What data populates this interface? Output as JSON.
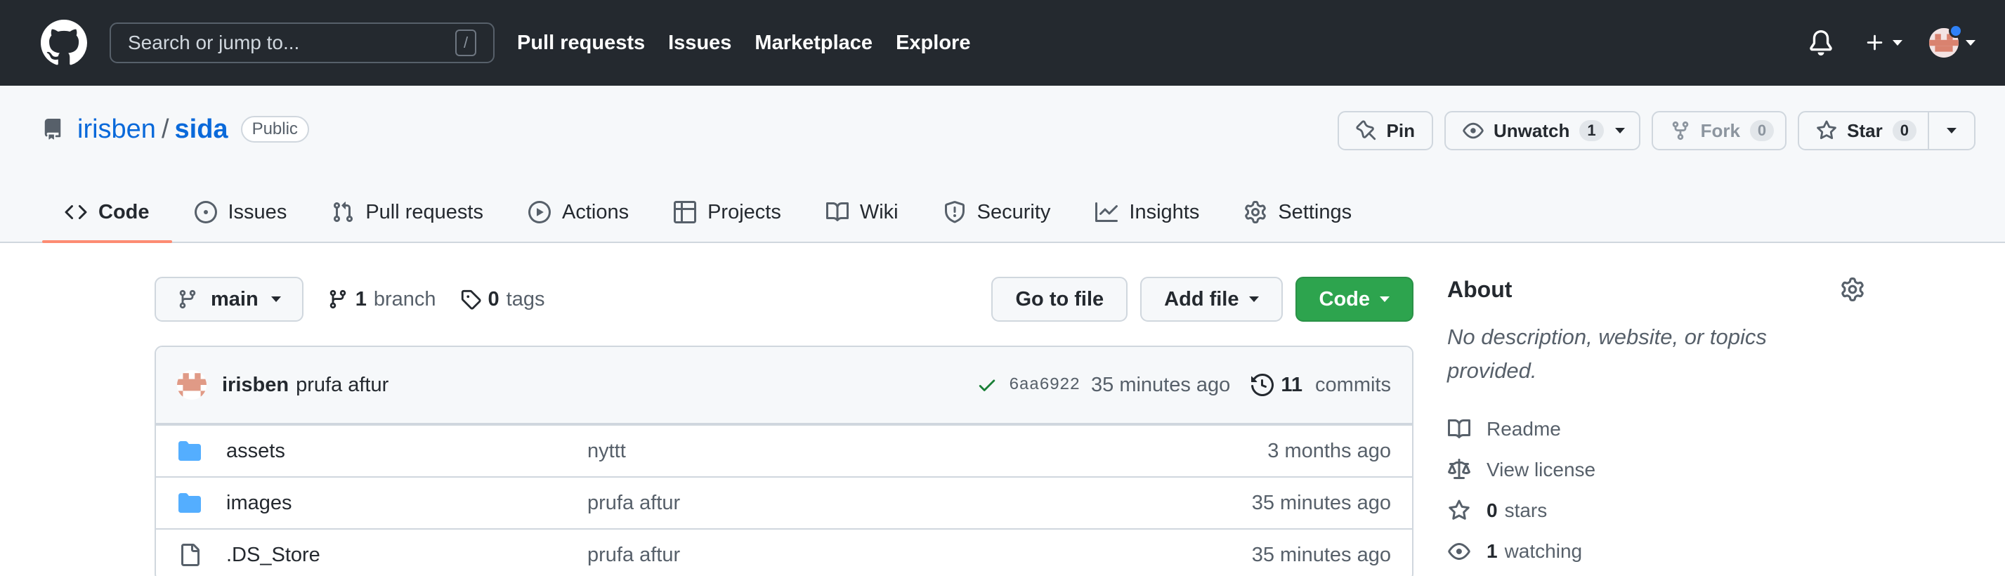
{
  "header": {
    "search_placeholder": "Search or jump to...",
    "search_shortcut": "/",
    "nav": [
      "Pull requests",
      "Issues",
      "Marketplace",
      "Explore"
    ]
  },
  "repo": {
    "owner": "irisben",
    "separator": "/",
    "name": "sida",
    "visibility": "Public",
    "actions": {
      "pin": "Pin",
      "unwatch": "Unwatch",
      "unwatch_count": "1",
      "fork": "Fork",
      "fork_count": "0",
      "star": "Star",
      "star_count": "0"
    },
    "tabs": [
      "Code",
      "Issues",
      "Pull requests",
      "Actions",
      "Projects",
      "Wiki",
      "Security",
      "Insights",
      "Settings"
    ]
  },
  "toolbar": {
    "branch": "main",
    "branch_count": "1",
    "branch_word": "branch",
    "tag_count": "0",
    "tag_word": "tags",
    "go_to_file": "Go to file",
    "add_file": "Add file",
    "code": "Code"
  },
  "latest_commit": {
    "author": "irisben",
    "message": "prufa aftur",
    "sha": "6aa6922",
    "time": "35 minutes ago",
    "commit_count": "11",
    "commit_word": "commits"
  },
  "files": [
    {
      "type": "folder",
      "name": "assets",
      "message": "nyttt",
      "time": "3 months ago"
    },
    {
      "type": "folder",
      "name": "images",
      "message": "prufa aftur",
      "time": "35 minutes ago"
    },
    {
      "type": "file",
      "name": ".DS_Store",
      "message": "prufa aftur",
      "time": "35 minutes ago"
    }
  ],
  "about": {
    "title": "About",
    "description": "No description, website, or topics provided.",
    "readme": "Readme",
    "license": "View license",
    "stars_count": "0",
    "stars_word": "stars",
    "watching_count": "1",
    "watching_word": "watching"
  },
  "colors": {
    "header_bg": "#24292f",
    "link_blue": "#0969da",
    "code_green": "#2da44e",
    "active_tab_underline": "#fd8c73",
    "folder_blue": "#54aeff"
  }
}
